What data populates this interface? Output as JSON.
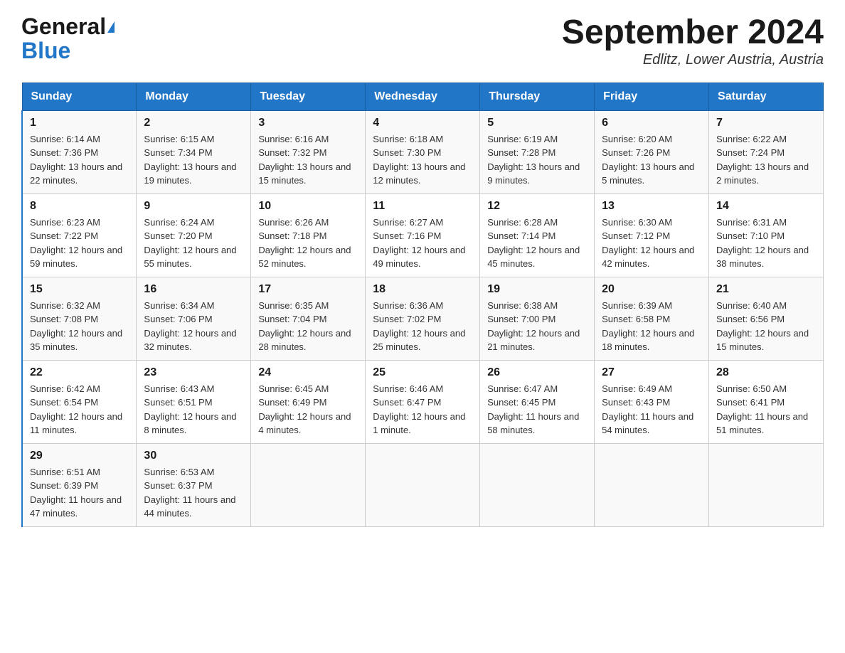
{
  "header": {
    "logo_general": "General",
    "logo_blue": "Blue",
    "month_title": "September 2024",
    "location": "Edlitz, Lower Austria, Austria"
  },
  "days_of_week": [
    "Sunday",
    "Monday",
    "Tuesday",
    "Wednesday",
    "Thursday",
    "Friday",
    "Saturday"
  ],
  "weeks": [
    [
      {
        "day": "1",
        "sunrise": "Sunrise: 6:14 AM",
        "sunset": "Sunset: 7:36 PM",
        "daylight": "Daylight: 13 hours and 22 minutes."
      },
      {
        "day": "2",
        "sunrise": "Sunrise: 6:15 AM",
        "sunset": "Sunset: 7:34 PM",
        "daylight": "Daylight: 13 hours and 19 minutes."
      },
      {
        "day": "3",
        "sunrise": "Sunrise: 6:16 AM",
        "sunset": "Sunset: 7:32 PM",
        "daylight": "Daylight: 13 hours and 15 minutes."
      },
      {
        "day": "4",
        "sunrise": "Sunrise: 6:18 AM",
        "sunset": "Sunset: 7:30 PM",
        "daylight": "Daylight: 13 hours and 12 minutes."
      },
      {
        "day": "5",
        "sunrise": "Sunrise: 6:19 AM",
        "sunset": "Sunset: 7:28 PM",
        "daylight": "Daylight: 13 hours and 9 minutes."
      },
      {
        "day": "6",
        "sunrise": "Sunrise: 6:20 AM",
        "sunset": "Sunset: 7:26 PM",
        "daylight": "Daylight: 13 hours and 5 minutes."
      },
      {
        "day": "7",
        "sunrise": "Sunrise: 6:22 AM",
        "sunset": "Sunset: 7:24 PM",
        "daylight": "Daylight: 13 hours and 2 minutes."
      }
    ],
    [
      {
        "day": "8",
        "sunrise": "Sunrise: 6:23 AM",
        "sunset": "Sunset: 7:22 PM",
        "daylight": "Daylight: 12 hours and 59 minutes."
      },
      {
        "day": "9",
        "sunrise": "Sunrise: 6:24 AM",
        "sunset": "Sunset: 7:20 PM",
        "daylight": "Daylight: 12 hours and 55 minutes."
      },
      {
        "day": "10",
        "sunrise": "Sunrise: 6:26 AM",
        "sunset": "Sunset: 7:18 PM",
        "daylight": "Daylight: 12 hours and 52 minutes."
      },
      {
        "day": "11",
        "sunrise": "Sunrise: 6:27 AM",
        "sunset": "Sunset: 7:16 PM",
        "daylight": "Daylight: 12 hours and 49 minutes."
      },
      {
        "day": "12",
        "sunrise": "Sunrise: 6:28 AM",
        "sunset": "Sunset: 7:14 PM",
        "daylight": "Daylight: 12 hours and 45 minutes."
      },
      {
        "day": "13",
        "sunrise": "Sunrise: 6:30 AM",
        "sunset": "Sunset: 7:12 PM",
        "daylight": "Daylight: 12 hours and 42 minutes."
      },
      {
        "day": "14",
        "sunrise": "Sunrise: 6:31 AM",
        "sunset": "Sunset: 7:10 PM",
        "daylight": "Daylight: 12 hours and 38 minutes."
      }
    ],
    [
      {
        "day": "15",
        "sunrise": "Sunrise: 6:32 AM",
        "sunset": "Sunset: 7:08 PM",
        "daylight": "Daylight: 12 hours and 35 minutes."
      },
      {
        "day": "16",
        "sunrise": "Sunrise: 6:34 AM",
        "sunset": "Sunset: 7:06 PM",
        "daylight": "Daylight: 12 hours and 32 minutes."
      },
      {
        "day": "17",
        "sunrise": "Sunrise: 6:35 AM",
        "sunset": "Sunset: 7:04 PM",
        "daylight": "Daylight: 12 hours and 28 minutes."
      },
      {
        "day": "18",
        "sunrise": "Sunrise: 6:36 AM",
        "sunset": "Sunset: 7:02 PM",
        "daylight": "Daylight: 12 hours and 25 minutes."
      },
      {
        "day": "19",
        "sunrise": "Sunrise: 6:38 AM",
        "sunset": "Sunset: 7:00 PM",
        "daylight": "Daylight: 12 hours and 21 minutes."
      },
      {
        "day": "20",
        "sunrise": "Sunrise: 6:39 AM",
        "sunset": "Sunset: 6:58 PM",
        "daylight": "Daylight: 12 hours and 18 minutes."
      },
      {
        "day": "21",
        "sunrise": "Sunrise: 6:40 AM",
        "sunset": "Sunset: 6:56 PM",
        "daylight": "Daylight: 12 hours and 15 minutes."
      }
    ],
    [
      {
        "day": "22",
        "sunrise": "Sunrise: 6:42 AM",
        "sunset": "Sunset: 6:54 PM",
        "daylight": "Daylight: 12 hours and 11 minutes."
      },
      {
        "day": "23",
        "sunrise": "Sunrise: 6:43 AM",
        "sunset": "Sunset: 6:51 PM",
        "daylight": "Daylight: 12 hours and 8 minutes."
      },
      {
        "day": "24",
        "sunrise": "Sunrise: 6:45 AM",
        "sunset": "Sunset: 6:49 PM",
        "daylight": "Daylight: 12 hours and 4 minutes."
      },
      {
        "day": "25",
        "sunrise": "Sunrise: 6:46 AM",
        "sunset": "Sunset: 6:47 PM",
        "daylight": "Daylight: 12 hours and 1 minute."
      },
      {
        "day": "26",
        "sunrise": "Sunrise: 6:47 AM",
        "sunset": "Sunset: 6:45 PM",
        "daylight": "Daylight: 11 hours and 58 minutes."
      },
      {
        "day": "27",
        "sunrise": "Sunrise: 6:49 AM",
        "sunset": "Sunset: 6:43 PM",
        "daylight": "Daylight: 11 hours and 54 minutes."
      },
      {
        "day": "28",
        "sunrise": "Sunrise: 6:50 AM",
        "sunset": "Sunset: 6:41 PM",
        "daylight": "Daylight: 11 hours and 51 minutes."
      }
    ],
    [
      {
        "day": "29",
        "sunrise": "Sunrise: 6:51 AM",
        "sunset": "Sunset: 6:39 PM",
        "daylight": "Daylight: 11 hours and 47 minutes."
      },
      {
        "day": "30",
        "sunrise": "Sunrise: 6:53 AM",
        "sunset": "Sunset: 6:37 PM",
        "daylight": "Daylight: 11 hours and 44 minutes."
      },
      null,
      null,
      null,
      null,
      null
    ]
  ]
}
